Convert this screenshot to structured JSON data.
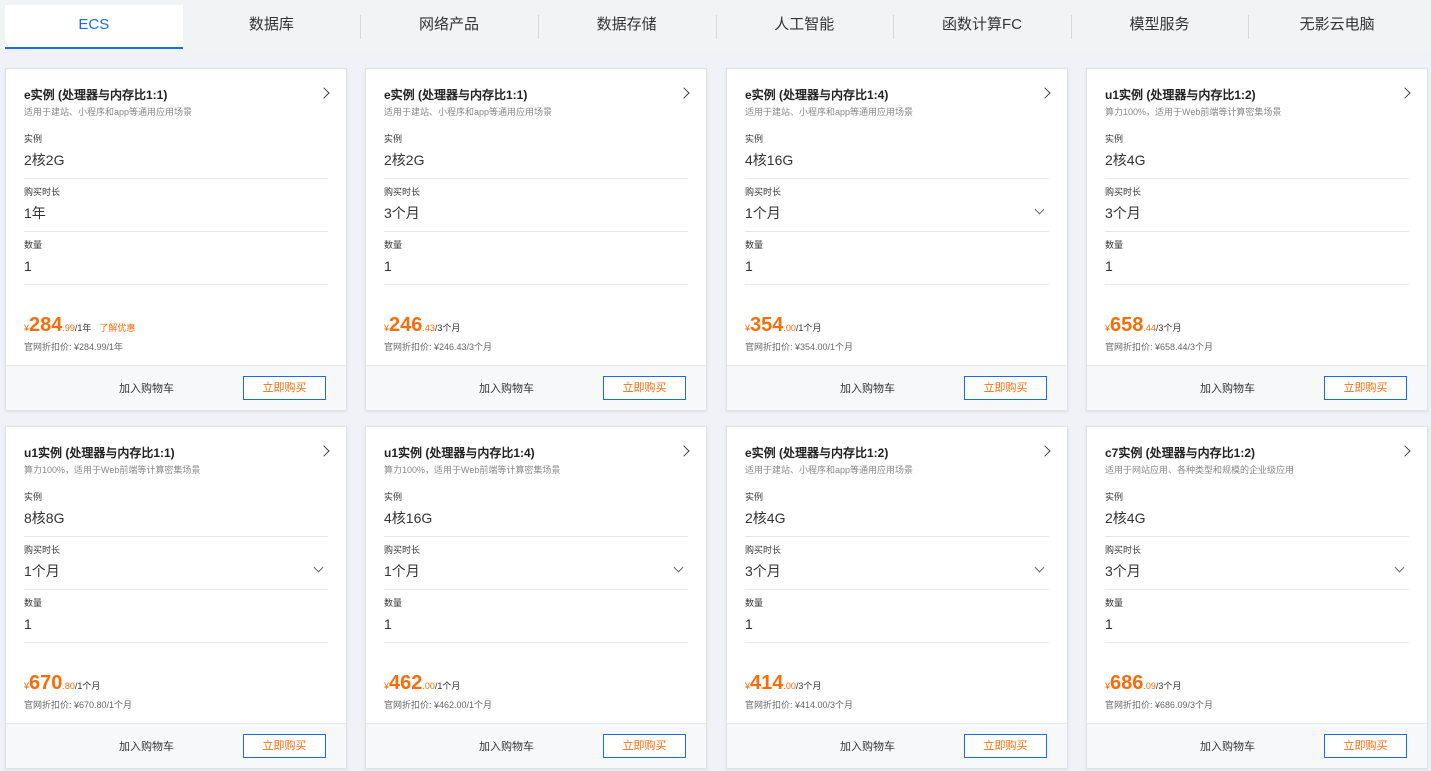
{
  "tabs": [
    "ECS",
    "数据库",
    "网络产品",
    "数据存储",
    "人工智能",
    "函数计算FC",
    "模型服务",
    "无影云电脑"
  ],
  "active_tab": 0,
  "labels": {
    "instance": "实例",
    "duration": "购买时长",
    "quantity": "数量",
    "official_prefix": "官网折扣价: ",
    "add_to_cart": "加入购物车",
    "buy_now": "立即购买",
    "promo": "了解优惠",
    "yen": "¥"
  },
  "cards": [
    {
      "title": "e实例 (处理器与内存比1:1)",
      "desc": "适用于建站、小程序和app等通用应用场景",
      "instance": "2核2G",
      "duration": "1年",
      "dropdown": false,
      "quantity": "1",
      "price_int": "284",
      "price_dec": ".99",
      "price_unit": "/1年",
      "promo": true,
      "official": "¥284.99/1年"
    },
    {
      "title": "e实例 (处理器与内存比1:1)",
      "desc": "适用于建站、小程序和app等通用应用场景",
      "instance": "2核2G",
      "duration": "3个月",
      "dropdown": false,
      "quantity": "1",
      "price_int": "246",
      "price_dec": ".43",
      "price_unit": "/3个月",
      "promo": false,
      "official": "¥246.43/3个月"
    },
    {
      "title": "e实例 (处理器与内存比1:4)",
      "desc": "适用于建站、小程序和app等通用应用场景",
      "instance": "4核16G",
      "duration": "1个月",
      "dropdown": true,
      "quantity": "1",
      "price_int": "354",
      "price_dec": ".00",
      "price_unit": "/1个月",
      "promo": false,
      "official": "¥354.00/1个月"
    },
    {
      "title": "u1实例 (处理器与内存比1:2)",
      "desc": "算力100%，适用于Web前端等计算密集场景",
      "instance": "2核4G",
      "duration": "3个月",
      "dropdown": false,
      "quantity": "1",
      "price_int": "658",
      "price_dec": ".44",
      "price_unit": "/3个月",
      "promo": false,
      "official": "¥658.44/3个月"
    },
    {
      "title": "u1实例 (处理器与内存比1:1)",
      "desc": "算力100%，适用于Web前端等计算密集场景",
      "instance": "8核8G",
      "duration": "1个月",
      "dropdown": true,
      "quantity": "1",
      "price_int": "670",
      "price_dec": ".80",
      "price_unit": "/1个月",
      "promo": false,
      "official": "¥670.80/1个月"
    },
    {
      "title": "u1实例 (处理器与内存比1:4)",
      "desc": "算力100%，适用于Web前端等计算密集场景",
      "instance": "4核16G",
      "duration": "1个月",
      "dropdown": true,
      "quantity": "1",
      "price_int": "462",
      "price_dec": ".00",
      "price_unit": "/1个月",
      "promo": false,
      "official": "¥462.00/1个月"
    },
    {
      "title": "e实例 (处理器与内存比1:2)",
      "desc": "适用于建站、小程序和app等通用应用场景",
      "instance": "2核4G",
      "duration": "3个月",
      "dropdown": true,
      "quantity": "1",
      "price_int": "414",
      "price_dec": ".00",
      "price_unit": "/3个月",
      "promo": false,
      "official": "¥414.00/3个月"
    },
    {
      "title": "c7实例 (处理器与内存比1:2)",
      "desc": "适用于网站应用、各种类型和规模的企业级应用",
      "instance": "2核4G",
      "duration": "3个月",
      "dropdown": true,
      "quantity": "1",
      "price_int": "686",
      "price_dec": ".09",
      "price_unit": "/3个月",
      "promo": false,
      "official": "¥686.09/3个月"
    }
  ]
}
